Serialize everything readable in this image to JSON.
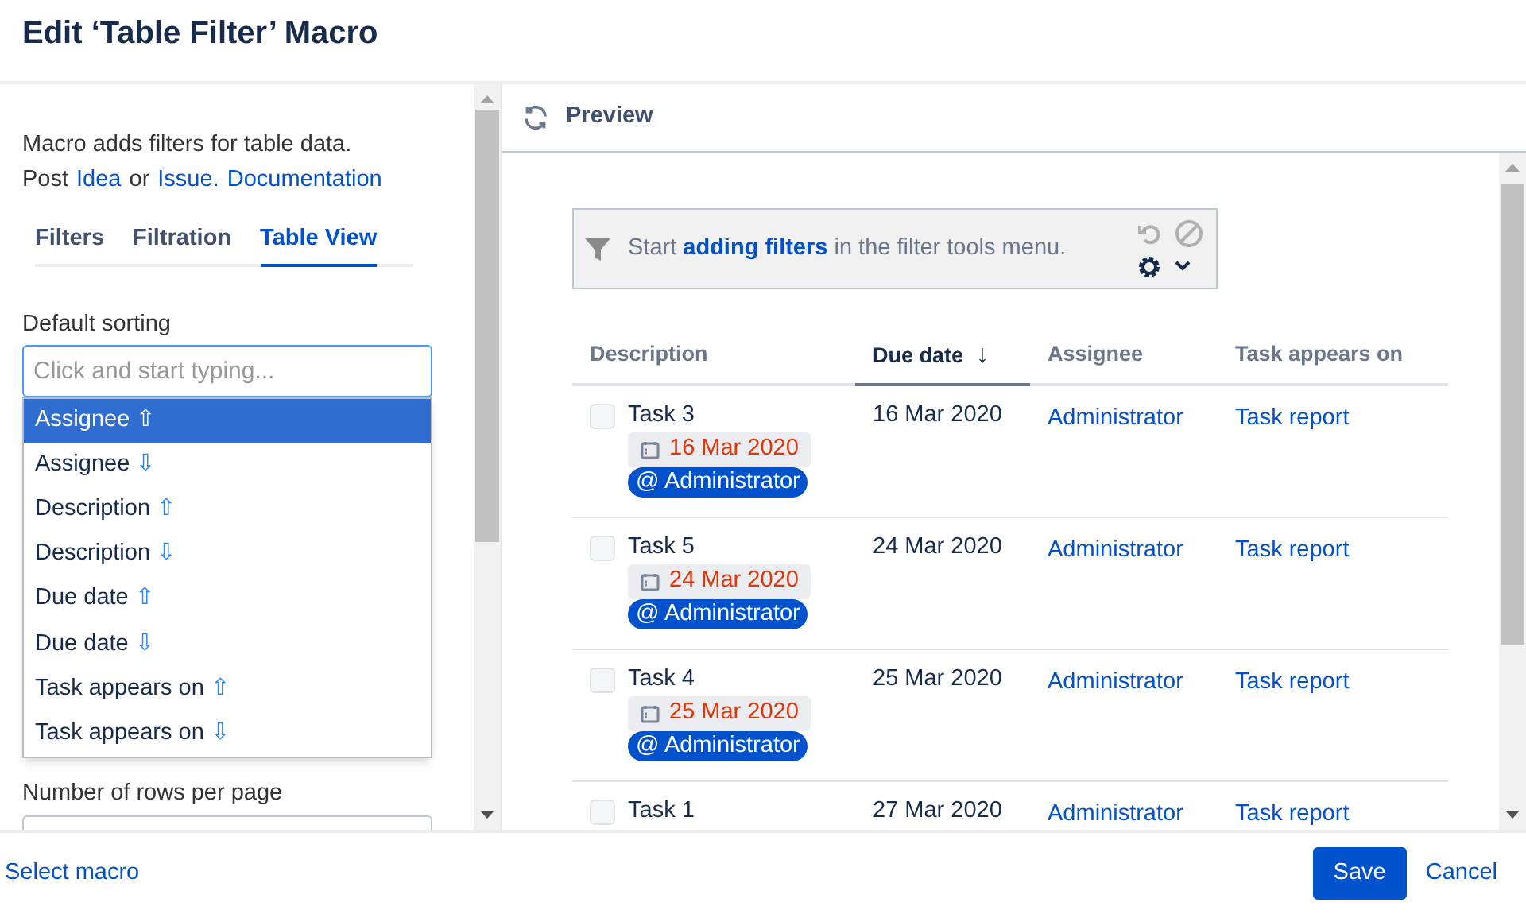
{
  "dialog": {
    "title": "Edit ‘Table Filter’ Macro"
  },
  "sidebar": {
    "intro": "Macro adds filters for table data.",
    "post_prefix": "Post",
    "links": [
      {
        "text": "Idea"
      },
      {
        "text": "or",
        "kind": "plain"
      },
      {
        "text": "Issue."
      },
      {
        "text": "Documentation"
      }
    ],
    "tabs": [
      {
        "label": "Filters",
        "selected": false
      },
      {
        "label": "Filtration",
        "selected": false
      },
      {
        "label": "Table View",
        "selected": true
      }
    ],
    "default_sorting": {
      "label": "Default sorting",
      "placeholder": "Click and start typing...",
      "options": [
        {
          "label": "Assignee",
          "arrow": "⇧",
          "selected": true
        },
        {
          "label": "Assignee",
          "arrow": "⇩",
          "selected": false
        },
        {
          "label": "Description",
          "arrow": "⇧",
          "selected": false
        },
        {
          "label": "Description",
          "arrow": "⇩",
          "selected": false
        },
        {
          "label": "Due date",
          "arrow": "⇧",
          "selected": false
        },
        {
          "label": "Due date",
          "arrow": "⇩",
          "selected": false
        },
        {
          "label": "Task appears on",
          "arrow": "⇧",
          "selected": false
        },
        {
          "label": "Task appears on",
          "arrow": "⇩",
          "selected": false
        }
      ]
    },
    "rows_per_page": {
      "label": "Number of rows per page"
    }
  },
  "preview": {
    "title": "Preview",
    "filter_bar": {
      "text": "Start **adding filters** in the filter tools menu."
    },
    "table": {
      "columns": [
        {
          "label": "Description",
          "sorted": false
        },
        {
          "label": "Due date",
          "sorted": true,
          "arrow": "↓"
        },
        {
          "label": "Assignee",
          "sorted": false
        },
        {
          "label": "Task appears on",
          "sorted": false
        }
      ],
      "rows": [
        {
          "task": "Task 3",
          "checked": false,
          "lozenge_date": "16 Mar 2020",
          "mention": "@ Administrator",
          "due": "16 Mar 2020",
          "assignee": "Administrator",
          "page": "Task report"
        },
        {
          "task": "Task 5",
          "checked": false,
          "lozenge_date": "24 Mar 2020",
          "mention": "@ Administrator",
          "due": "24 Mar 2020",
          "assignee": "Administrator",
          "page": "Task report"
        },
        {
          "task": "Task 4",
          "checked": false,
          "lozenge_date": "25 Mar 2020",
          "mention": "@ Administrator",
          "due": "25 Mar 2020",
          "assignee": "Administrator",
          "page": "Task report"
        },
        {
          "task": "Task 1",
          "checked": false,
          "due": "27 Mar 2020",
          "assignee": "Administrator",
          "page": "Task report"
        }
      ]
    }
  },
  "footer": {
    "link": "Select macro",
    "buttons": [
      {
        "label": "Save",
        "kind": "primary"
      },
      {
        "label": "Cancel",
        "kind": "link"
      }
    ]
  }
}
